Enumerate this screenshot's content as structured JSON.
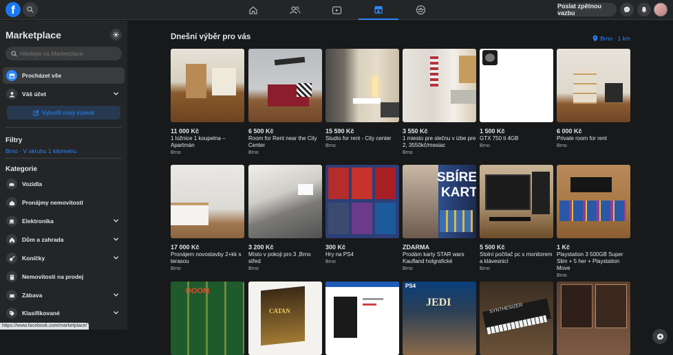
{
  "topbar": {
    "feedback_label": "Poslat zpětnou vazbu",
    "logo_letter": "f"
  },
  "sidebar": {
    "title": "Marketplace",
    "search_placeholder": "Hledejte na Marketplace",
    "nav": [
      {
        "label": "Procházet vše",
        "icon": "storefront-icon"
      },
      {
        "label": "Váš účet",
        "icon": "user-icon"
      }
    ],
    "create_label": "Vytvořit nový inzerát",
    "filters_heading": "Filtry",
    "filters_link": "Brno · V okruhu 1 kilometru",
    "categories_heading": "Kategorie",
    "categories": [
      {
        "label": "Vozidla",
        "icon": "car-icon",
        "expandable": false
      },
      {
        "label": "Pronájmy nemovitostí",
        "icon": "house-key-icon",
        "expandable": false
      },
      {
        "label": "Elektronika",
        "icon": "laptop-icon",
        "expandable": true
      },
      {
        "label": "Dům a zahrada",
        "icon": "home-icon",
        "expandable": true
      },
      {
        "label": "Koníčky",
        "icon": "guitar-icon",
        "expandable": true
      },
      {
        "label": "Nemovitosti na prodej",
        "icon": "building-icon",
        "expandable": false
      },
      {
        "label": "Zábava",
        "icon": "ticket-icon",
        "expandable": true
      },
      {
        "label": "Klasifikované",
        "icon": "tag-icon",
        "expandable": true
      }
    ]
  },
  "status_url": "https://www.facebook.com/marketplace/",
  "main": {
    "title": "Dnešní výběr pro vás",
    "location": "Brno · 1 km",
    "listings": [
      {
        "price": "11 000 Kč",
        "title": "1 ložnice 1 koupelna – Apartmán",
        "city": "Brno"
      },
      {
        "price": "6 500 Kč",
        "title": "Room for Rent near the City Center",
        "city": "Brno"
      },
      {
        "price": "15 590 Kč",
        "title": "Studio for rent - City center",
        "city": "Brno"
      },
      {
        "price": "3 550 Kč",
        "title": "1 miesto pre slečnu v izbe pre 2, 3550kč/mesiac",
        "city": "Brno"
      },
      {
        "price": "1 500 Kč",
        "title": "GTX 750 ti 4GB",
        "city": "Brno"
      },
      {
        "price": "6 000 Kč",
        "title": "Private room for rent",
        "city": "Brno"
      },
      {
        "price": "17 000 Kč",
        "title": "Pronájem novostavby 2+kk s terasou",
        "city": "Brno"
      },
      {
        "price": "3 200 Kč",
        "title": "Místo v pokoji pro 3 ,Brno střed",
        "city": "Brno"
      },
      {
        "price": "300 Kč",
        "title": "Hry na PS4",
        "city": "Brno"
      },
      {
        "price": "ZDARMA",
        "title": "Prodám karty STAR wars Kaufland holgrafické",
        "city": "Brno"
      },
      {
        "price": "5 500 Kč",
        "title": "Stolní počítač pc s monitorem a klávesnicí",
        "city": "Brno"
      },
      {
        "price": "1 Kč",
        "title": "Playstation 3 500GB Super Slim + 5 her + Playstation Move",
        "city": "Brno"
      }
    ],
    "poster_texts": {
      "cards_top": "SBÍRE",
      "cards_bottom": "KART",
      "jedi": "JEDI",
      "ps4": "PS4",
      "synth": "SYNTHESIZER",
      "catan": "CATAN",
      "doom": "DOOM"
    }
  }
}
